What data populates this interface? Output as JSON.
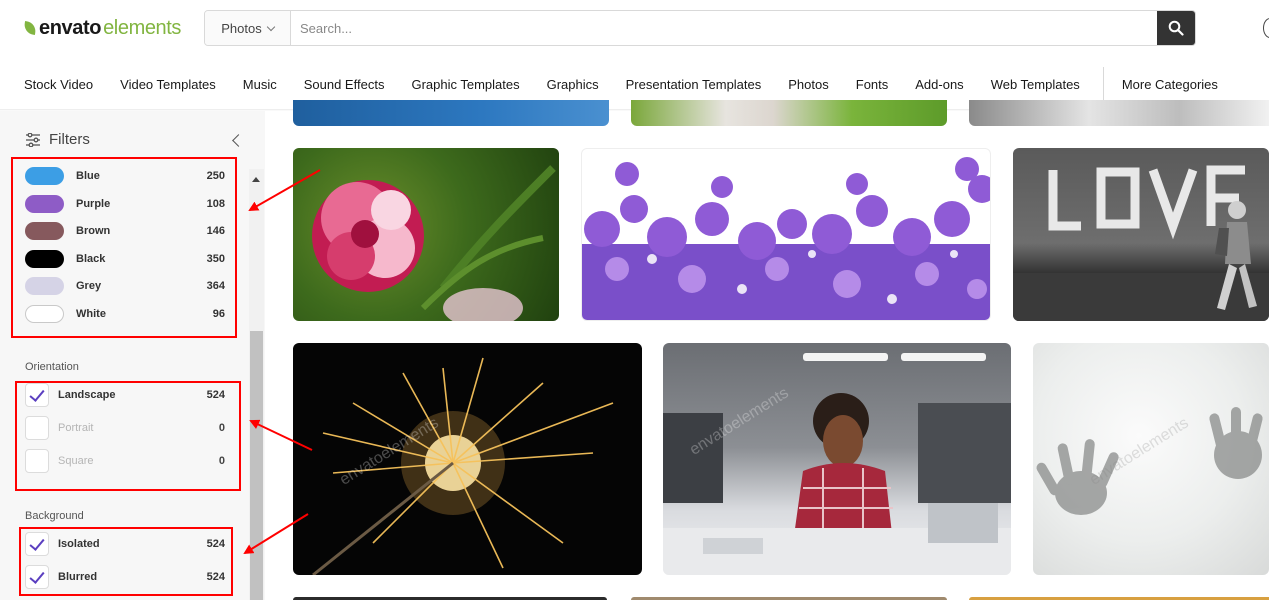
{
  "logo": {
    "part1": "envato",
    "part2": "elements",
    "leaf_color": "#82b541"
  },
  "search": {
    "category": "Photos",
    "placeholder": "Search...",
    "button_icon": "search-icon"
  },
  "nav": {
    "items": [
      "Stock Video",
      "Video Templates",
      "Music",
      "Sound Effects",
      "Graphic Templates",
      "Graphics",
      "Presentation Templates",
      "Photos",
      "Fonts",
      "Add-ons",
      "Web Templates"
    ],
    "more": "More Categories"
  },
  "sidebar": {
    "title": "Filters",
    "title_icon": "sliders-icon",
    "collapse_icon": "chevron-left-icon",
    "colors": [
      {
        "label": "Blue",
        "count": "250",
        "swatch": "#3c9ee5"
      },
      {
        "label": "Purple",
        "count": "108",
        "swatch": "#8e5cc6"
      },
      {
        "label": "Brown",
        "count": "146",
        "swatch": "#86595d"
      },
      {
        "label": "Black",
        "count": "350",
        "swatch": "#000000"
      },
      {
        "label": "Grey",
        "count": "364",
        "swatch": "#d5d3e6"
      },
      {
        "label": "White",
        "count": "96",
        "swatch": "#ffffff"
      }
    ],
    "orientation": {
      "label": "Orientation",
      "options": [
        {
          "label": "Landscape",
          "count": "524",
          "checked": true
        },
        {
          "label": "Portrait",
          "count": "0",
          "checked": false
        },
        {
          "label": "Square",
          "count": "0",
          "checked": false
        }
      ]
    },
    "background": {
      "label": "Background",
      "options": [
        {
          "label": "Isolated",
          "count": "524",
          "checked": true
        },
        {
          "label": "Blurred",
          "count": "524",
          "checked": true
        }
      ]
    }
  },
  "thumbnails": {
    "watermark": "envatoelements",
    "items": [
      "pink-carnation",
      "purple-bellflowers",
      "love-wall-man",
      "sparkler",
      "woman-office",
      "hands-glass"
    ]
  },
  "annotation_color": "#ff0000",
  "accent_check_color": "#5b3fc0"
}
